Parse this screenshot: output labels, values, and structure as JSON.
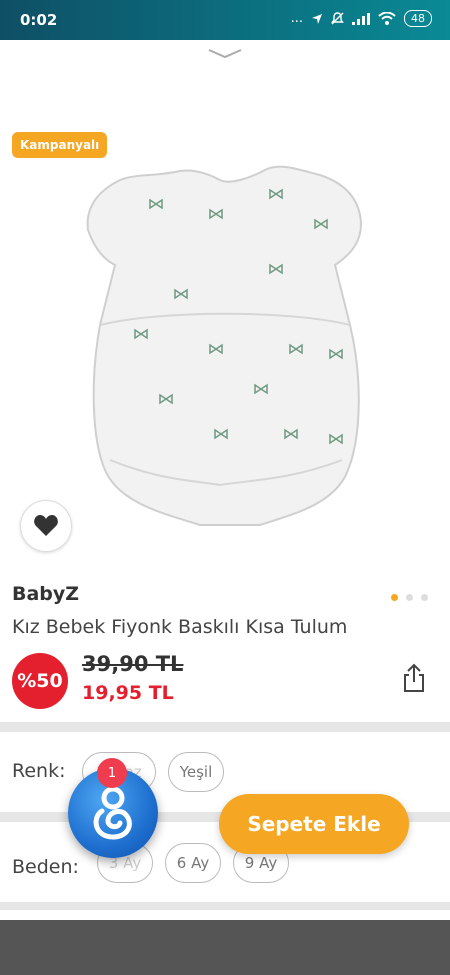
{
  "status_bar": {
    "time": "0:02",
    "indicators": "...",
    "battery": "48"
  },
  "product": {
    "badge": "Kampanyalı",
    "brand": "BabyZ",
    "title": "Kız Bebek Fiyonk Baskılı Kısa Tulum",
    "discount": "%50",
    "old_price": "39,90 TL",
    "new_price": "19,95 TL",
    "image_pages": 3,
    "current_page": 1
  },
  "options": {
    "color_label": "Renk:",
    "colors": [
      "Beyaz",
      "Yeşil"
    ],
    "size_label": "Beden:",
    "sizes": [
      "3 Ay",
      "6 Ay",
      "9 Ay"
    ]
  },
  "fab": {
    "count": "1"
  },
  "actions": {
    "add_to_cart": "Sepete Ekle"
  },
  "colors": {
    "accent": "#f5a623",
    "sale": "#e4202f",
    "status_bar": "#0b6f7f"
  }
}
